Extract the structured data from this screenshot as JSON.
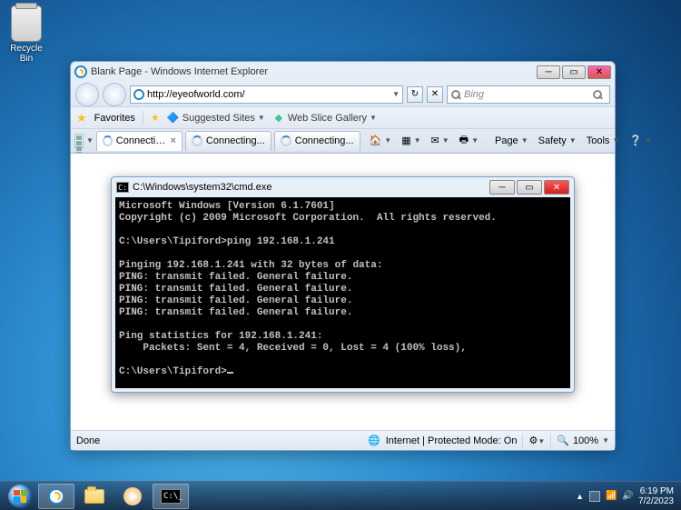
{
  "desktop": {
    "recycle_bin": "Recycle Bin"
  },
  "ie": {
    "title": "Blank Page - Windows Internet Explorer",
    "url": "http://eyeofworld.com/",
    "search_placeholder": "Bing",
    "favorites_label": "Favorites",
    "suggested_sites": "Suggested Sites",
    "web_slice": "Web Slice Gallery",
    "tabs": [
      "Connecting...",
      "Connecting...",
      "Connecting..."
    ],
    "tools": {
      "page": "Page",
      "safety": "Safety",
      "tools": "Tools"
    },
    "status_done": "Done",
    "status_zone": "Internet | Protected Mode: On",
    "zoom": "100%"
  },
  "cmd": {
    "title": "C:\\Windows\\system32\\cmd.exe",
    "lines": [
      "Microsoft Windows [Version 6.1.7601]",
      "Copyright (c) 2009 Microsoft Corporation.  All rights reserved.",
      "",
      "C:\\Users\\Tipiford>ping 192.168.1.241",
      "",
      "Pinging 192.168.1.241 with 32 bytes of data:",
      "PING: transmit failed. General failure.",
      "PING: transmit failed. General failure.",
      "PING: transmit failed. General failure.",
      "PING: transmit failed. General failure.",
      "",
      "Ping statistics for 192.168.1.241:",
      "    Packets: Sent = 4, Received = 0, Lost = 4 (100% loss),",
      "",
      "C:\\Users\\Tipiford>"
    ]
  },
  "taskbar": {
    "time": "6:19 PM",
    "date": "7/2/2023"
  }
}
